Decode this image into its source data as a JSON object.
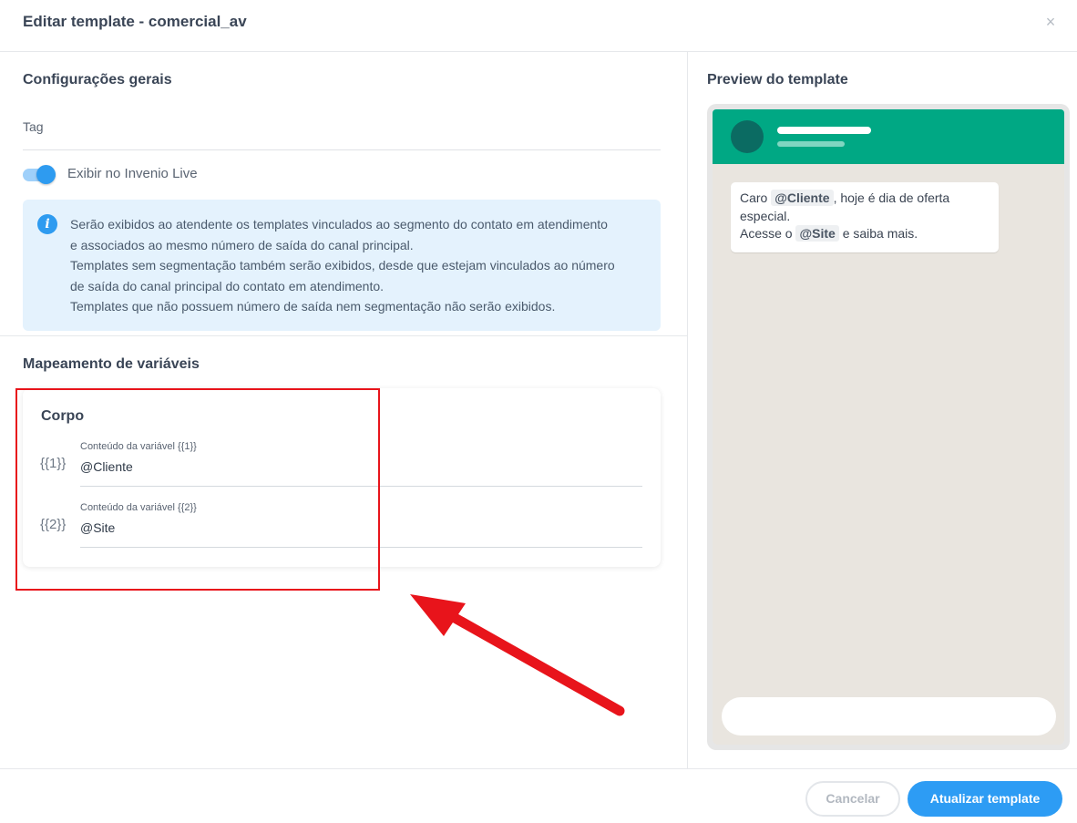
{
  "modal": {
    "title": "Editar template - comercial_av",
    "close_icon": "close-icon",
    "close_glyph": "×"
  },
  "general": {
    "section_title": "Configurações gerais",
    "tag_label": "Tag",
    "tag_value": "",
    "toggle": {
      "label": "Exibir no Invenio Live",
      "checked": true
    },
    "info": {
      "icon": "info-icon",
      "icon_glyph": "i",
      "lines": [
        "Serão exibidos ao atendente os templates vinculados ao segmento do contato em atendimento",
        "e associados ao mesmo número de saída do canal principal.",
        "Templates sem segmentação também serão exibidos, desde que estejam vinculados ao número",
        "de saída do canal principal do contato em atendimento.",
        "Templates que não possuem número de saída nem segmentação não serão exibidos."
      ]
    }
  },
  "mapping": {
    "section_title": "Mapeamento de variáveis",
    "card_title": "Corpo",
    "variables": [
      {
        "token": "{{1}}",
        "label": "Conteúdo da variável {{1}}",
        "value": "@Cliente"
      },
      {
        "token": "{{2}}",
        "label": "Conteúdo da variável {{2}}",
        "value": "@Site"
      }
    ]
  },
  "preview": {
    "section_title": "Preview do template",
    "message": {
      "p1": "Caro ",
      "chip1": "@Cliente",
      "p2": ", hoje é dia de oferta",
      "p3": "especial.",
      "p4": "Acesse o ",
      "chip2": "@Site",
      "p5": " e saiba mais."
    }
  },
  "footer": {
    "cancel_label": "Cancelar",
    "submit_label": "Atualizar template"
  },
  "colors": {
    "primary": "#2d9cf4",
    "whatsapp_header": "#00a884",
    "info_background": "#e4f2fd",
    "annotation_red": "#e8141b"
  }
}
